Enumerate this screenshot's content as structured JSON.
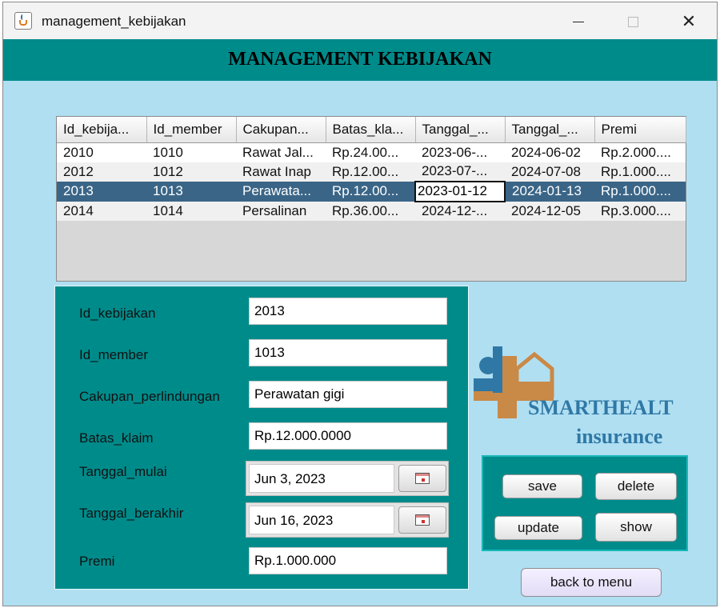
{
  "window": {
    "title": "management_kebijakan",
    "close_glyph": "✕"
  },
  "header": {
    "title": "MANAGEMENT KEBIJAKAN"
  },
  "table": {
    "columns": [
      "Id_kebija...",
      "Id_member",
      "Cakupan...",
      "Batas_kla...",
      "Tanggal_...",
      "Tanggal_...",
      "Premi"
    ],
    "rows": [
      [
        "2010",
        "1010",
        "Rawat Jal...",
        "Rp.24.00...",
        "2023-06-...",
        "2024-06-02",
        "Rp.2.000...."
      ],
      [
        "2012",
        "1012",
        "Rawat Inap",
        "Rp.12.00...",
        "2023-07-...",
        "2024-07-08",
        "Rp.1.000...."
      ],
      [
        "2013",
        "1013",
        "Perawata...",
        "Rp.12.00...",
        "2023-01-12",
        "2024-01-13",
        "Rp.1.000...."
      ],
      [
        "2014",
        "1014",
        "Persalinan",
        "Rp.36.00...",
        "2024-12-...",
        "2024-12-05",
        "Rp.3.000...."
      ]
    ]
  },
  "form": {
    "id_kebijakan": {
      "label": "Id_kebijakan",
      "value": "2013"
    },
    "id_member": {
      "label": "Id_member",
      "value": "1013"
    },
    "cakupan": {
      "label": "Cakupan_perlindungan",
      "value": "Perawatan gigi"
    },
    "batas_klaim": {
      "label": "Batas_klaim",
      "value": "Rp.12.000.0000"
    },
    "tanggal_mulai": {
      "label": "Tanggal_mulai",
      "value": "Jun 3, 2023"
    },
    "tanggal_berakhir": {
      "label": "Tanggal_berakhir",
      "value": "Jun 16, 2023"
    },
    "premi": {
      "label": "Premi",
      "value": "Rp.1.000.000"
    }
  },
  "logo": {
    "line1": "SMARTHEALT",
    "line2": "insurance"
  },
  "buttons": {
    "save": "save",
    "delete": "delete",
    "update": "update",
    "show": "show",
    "back": "back to menu"
  },
  "colors": {
    "accent": "#008b8b",
    "background": "#b0dff2",
    "selected_row": "#3a6587",
    "logo_blue": "#2f78a6",
    "logo_orange": "#c98947"
  }
}
